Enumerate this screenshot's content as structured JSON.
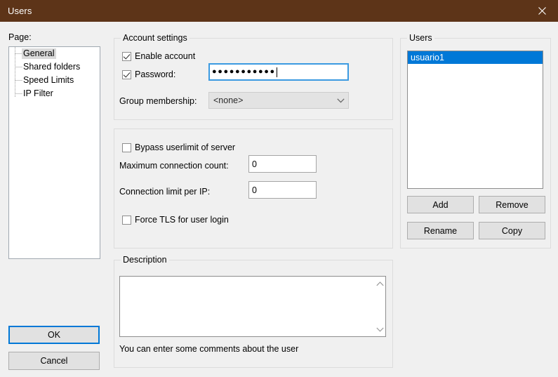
{
  "window": {
    "title": "Users",
    "close_icon": "close-icon",
    "titlebar_color": "#5d3418"
  },
  "left": {
    "page_label": "Page:",
    "tree_items": [
      {
        "label": "General",
        "selected": true
      },
      {
        "label": "Shared folders",
        "selected": false
      },
      {
        "label": "Speed Limits",
        "selected": false
      },
      {
        "label": "IP Filter",
        "selected": false
      }
    ],
    "ok_label": "OK",
    "cancel_label": "Cancel"
  },
  "account_settings": {
    "title": "Account settings",
    "enable_account": {
      "label": "Enable account",
      "checked": true
    },
    "password": {
      "label": "Password:",
      "checked": true,
      "value": "●●●●●●●●●●●",
      "focused": true
    },
    "group_membership": {
      "label": "Group membership:",
      "value": "<none>",
      "arrow_icon": "chevron-down-icon"
    }
  },
  "limits": {
    "bypass_userlimit": {
      "label": "Bypass userlimit of server",
      "checked": false
    },
    "max_connection_count": {
      "label": "Maximum connection count:",
      "value": "0"
    },
    "connection_limit_per_ip": {
      "label": "Connection limit per IP:",
      "value": "0"
    },
    "force_tls": {
      "label": "Force TLS for user login",
      "checked": false
    }
  },
  "description": {
    "title": "Description",
    "value": "",
    "hint": "You can enter some comments about the user",
    "scroll_up_icon": "chevron-up-icon",
    "scroll_down_icon": "chevron-down-icon"
  },
  "users": {
    "title": "Users",
    "items": [
      {
        "label": "usuario1",
        "selected": true
      }
    ],
    "buttons": {
      "add": "Add",
      "remove": "Remove",
      "rename": "Rename",
      "copy": "Copy"
    }
  },
  "colors": {
    "titlebar": "#5d3418",
    "selection": "#0078d7",
    "focus": "#0078d7",
    "dialog_bg": "#f0f0f0"
  }
}
